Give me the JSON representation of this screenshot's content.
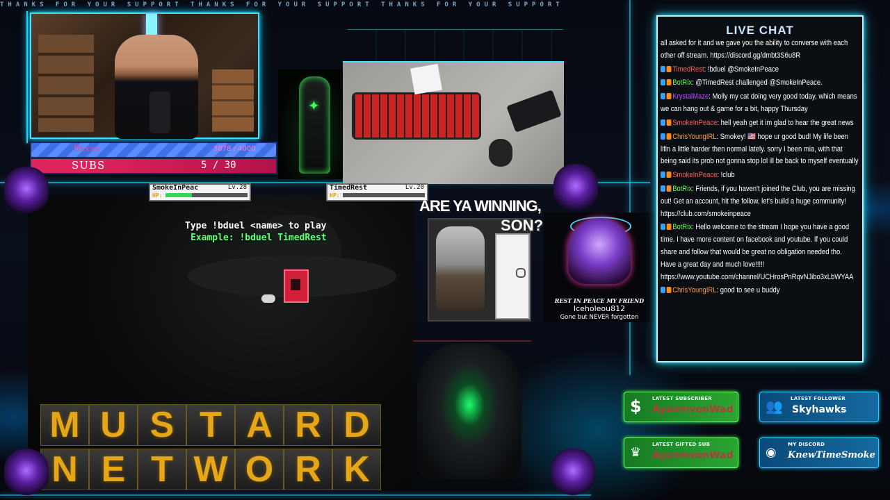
{
  "ticker": "THANKS FOR YOUR SUPPORT THANKS FOR YOUR SUPPORT THANKS FOR YOUR SUPPORT",
  "goal_bars": {
    "top": {
      "label": "Bxxxx",
      "value": "3878 / 4000",
      "fill_fraction": 1.0
    },
    "subs": {
      "label": "SUBS",
      "value": "5 / 30",
      "fill_fraction": 0.167
    }
  },
  "duel": {
    "player1": {
      "name": "SmokeInPeac",
      "level": "Lv.28",
      "hp_label": "HP:",
      "hp_fraction": 0.32
    },
    "player2": {
      "name": "TimedRest",
      "level": "Lv.20",
      "hp_label": "HP:",
      "hp_fraction": 0.0
    },
    "instruction": "Type !bduel <name> to play",
    "example": "Example: !bduel TimedRest"
  },
  "meme": {
    "line1": "ARE YA WINNING,",
    "line2": "SON?"
  },
  "memorial": {
    "title": "REST IN PEACE MY FRIEND",
    "name": "Iceholeou812",
    "subtitle": "Gone but NEVER forgotten"
  },
  "brand": {
    "row1": [
      "M",
      "U",
      "S",
      "T",
      "A",
      "R",
      "D"
    ],
    "row2": [
      "N",
      "E",
      "T",
      "W",
      "O",
      "R",
      "K"
    ]
  },
  "chat": {
    "title": "LIVE CHAT",
    "messages": [
      {
        "user": "",
        "text": "all asked for it and we gave you the ability to converse with each other off stream. https://discord.gg/dmbt3S6u8R",
        "ucolor": "u-purple"
      },
      {
        "user": "TimedRest",
        "text": ": !bduel @SmokeInPeace",
        "ucolor": "u-red"
      },
      {
        "user": "BotRix",
        "text": ": @TimedRest challenged @SmokeInPeace.",
        "ucolor": "u-green"
      },
      {
        "user": "KrystalMaze",
        "text": ": Molly my cat doing very good today, which means we can hang out & game for a bit, happy Thursday",
        "ucolor": "u-purple"
      },
      {
        "user": "SmokeInPeace",
        "text": ": hell yeah get it im glad to hear the great news",
        "ucolor": "u-red"
      },
      {
        "user": "ChrisYoungIRL",
        "text": ": Smokey! 🇺🇸 hope ur good bud! My life been lifin a little harder then normal lately. sorry I been mia, with that being said its prob not gonna stop lol ill be back to myself eventually",
        "ucolor": "u-orange"
      },
      {
        "user": "SmokeInPeace",
        "text": ": !club",
        "ucolor": "u-red"
      },
      {
        "user": "BotRix",
        "text": ": Friends, if you haven't joined the Club, you are missing out! Get an account, hit the follow, let's build a huge community! https://club.com/smokeinpeace",
        "ucolor": "u-green"
      },
      {
        "user": "BotRix",
        "text": ": Hello welcome to the stream I hope you have a good time. I have more content on facebook and youtube. If you could share and follow that would be great no obligation needed tho. Have a great day and much love!!!!! https://www.youtube.com/channel/UCHrosPnRqvNJibo3xLbWYAA",
        "ucolor": "u-green"
      },
      {
        "user": "ChrisYoungIRL",
        "text": ": good to see u buddy",
        "ucolor": "u-orange"
      }
    ]
  },
  "widgets": {
    "latest_subscriber": {
      "label": "LATEST SUBSCRIBER",
      "value": "AyanmvonWad",
      "icon": "dollar-icon"
    },
    "latest_follower": {
      "label": "LATEST FOLLOWER",
      "value": "Skyhawks",
      "icon": "people-icon"
    },
    "latest_gifted": {
      "label": "LATEST GIFTED SUB",
      "value": "AyanmvonWad",
      "icon": "crown-icon"
    },
    "discord": {
      "label": "MY DISCORD",
      "value": "KnewTimeSmoke",
      "icon": "discord-icon"
    }
  },
  "colors": {
    "accent": "#3ee3ff",
    "subs_bar": "#e0245e",
    "goal_bar": "#3f6fe6",
    "brand_gold": "#e5a719"
  }
}
